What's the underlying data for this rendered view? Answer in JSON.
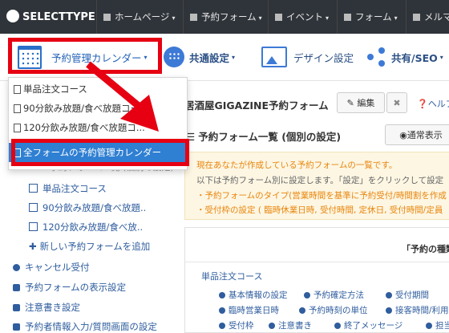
{
  "topnav": {
    "logo": "SELECTTYPE",
    "items": [
      {
        "label": "ホームページ",
        "icon": "home-icon"
      },
      {
        "label": "予約フォーム",
        "icon": "calendar-icon"
      },
      {
        "label": "イベント",
        "icon": "comment-icon"
      },
      {
        "label": "フォーム",
        "icon": "form-icon"
      },
      {
        "label": "メルマ",
        "icon": "mail-icon"
      }
    ],
    "caret": "▾"
  },
  "subbar": {
    "calendar_menu": "予約管理カレンダー",
    "common_settings": "共通設定",
    "design_settings": "デザイン設定",
    "share_seo": "共有/SEO"
  },
  "dropdown": {
    "items": [
      "単品注文コース",
      "90分飲み放題/食べ放題コース",
      "120分飲み放題/食べ放題コ..."
    ],
    "active_item": "全フォームの予約管理カレンダー"
  },
  "sidebar": {
    "partial_heading": "予約フォーム一覧 (個別の設定)",
    "forms": [
      "単品注文コース",
      "90分飲み放題/食べ放題..",
      "120分飲み放題/食べ放.."
    ],
    "add_form": "新しい予約フォームを追加",
    "menu": [
      "キャンセル受付",
      "予約フォームの表示設定",
      "注意書き設定",
      "予約者情報入力/質問画面の設定"
    ]
  },
  "main": {
    "site_title": "居酒屋GIGAZINE予約フォーム",
    "edit_button": "編集",
    "close_button": "✖",
    "help_link": "ヘルプ",
    "list_title": "予約フォーム一覧 (個別の設定)",
    "normal_view_button": "◉通常表示",
    "info": [
      "現在あなたが作成している予約フォームの一覧です。",
      "以下は予約フォーム別に設定します。「設定」をクリックして設定",
      "・予約フォームのタイプ(営業時間を基準に予約受付/時間割を作成",
      "・受付枠の設定 ( 臨時休業日時, 受付時間, 定休日, 受付時間/定員"
    ],
    "panel_header": "「予約の種類",
    "course_name": "単品注文コース",
    "links": [
      [
        "基本情報の設定",
        "予約確定方法",
        "受付期間"
      ],
      [
        "臨時営業日時",
        "予約時刻の単位",
        "接客時間/利用"
      ],
      [
        "受付枠",
        "注意書き",
        "終了メッセージ",
        "担当"
      ]
    ]
  },
  "colors": {
    "accent": "#2563b8",
    "highlight_red": "#e60012",
    "nav_bg": "#2f343a",
    "active_item": "#2f7fd2",
    "info_bg": "#fdf6e3"
  }
}
